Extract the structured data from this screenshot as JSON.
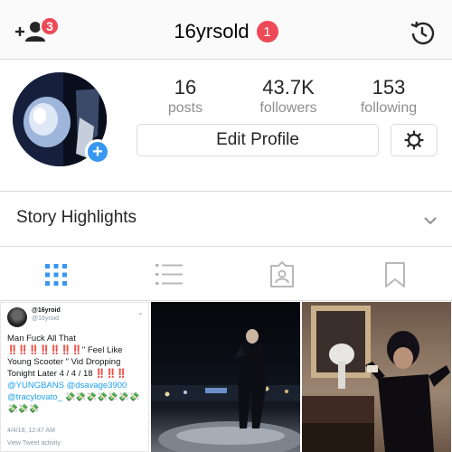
{
  "header": {
    "username": "16yrsold",
    "username_badge": "1",
    "add_people_badge": "3"
  },
  "profile": {
    "stats": [
      {
        "value": "16",
        "label": "posts"
      },
      {
        "value": "43.7K",
        "label": "followers"
      },
      {
        "value": "153",
        "label": "following"
      }
    ],
    "edit_profile_label": "Edit Profile"
  },
  "highlights": {
    "label": "Story Highlights"
  },
  "tabs": [
    {
      "icon": "grid-icon",
      "active": true
    },
    {
      "icon": "list-icon",
      "active": false
    },
    {
      "icon": "tagged-icon",
      "active": false
    },
    {
      "icon": "bookmark-icon",
      "active": false
    }
  ],
  "posts": {
    "tweet": {
      "name": "@16yroid",
      "handle": "@16yroid",
      "line1": "Man Fuck All That",
      "bangs1": "‼️‼️‼️‼️‼️‼️‼️",
      "line2": "Feel Like Young Scooter \" Vid Dropping Tonight Later 4 / 4 / 18",
      "bangs2": "‼️‼️‼️",
      "mention1": "@YUNGBANS",
      "mention2": "@dsavage3900 @tracylovato_",
      "emoji_row": "💸💸💸💸💸💸💸💸💸💸",
      "timestamp": "4/4/18, 12:47 AM",
      "activity": "View Tweet activity"
    }
  },
  "colors": {
    "badge": "#ed4956",
    "accent_blue": "#3897f0",
    "active_tab": "#3897f0",
    "inactive_tab": "#b8b8b8"
  }
}
